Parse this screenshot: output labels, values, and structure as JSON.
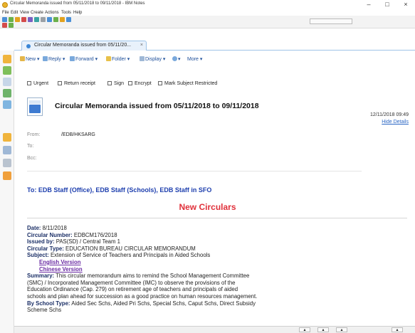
{
  "window": {
    "title": "Circular Memoranda issued from 05/11/2018 to 09/11/2018 - IBM Notes",
    "controls": {
      "minimize": "–",
      "maximize": "□",
      "close": "×"
    }
  },
  "menu": [
    "File",
    "Edit",
    "View",
    "Create",
    "Actions",
    "Tools",
    "Help"
  ],
  "tab": {
    "label": "Circular Memoranda issued from 05/11/20...",
    "close": "×"
  },
  "actions": {
    "new": "New",
    "reply": "Reply",
    "forward": "Forward",
    "folder": "Folder",
    "display": "Display",
    "more": "More"
  },
  "options": [
    "Urgent",
    "Return receipt",
    "Sign",
    "Encrypt",
    "Mark Subject Restricted"
  ],
  "message": {
    "subject": "Circular Memoranda issued from 05/11/2018 to 09/11/2018",
    "timestamp": "12/11/2018 09:49",
    "hide_details": "Hide Details",
    "from_label": "From:",
    "from_value": "/EDB/HKSARG",
    "to_label": "To:",
    "bcc_label": "Bcc:",
    "to_line": "To: EDB Staff (Office), EDB Staff (Schools), EDB Staff in SFO",
    "heading": "New Circulars"
  },
  "circular": {
    "date_label": "Date:",
    "date_value": "8/11/2018",
    "number_label": "Circular Number:",
    "number_value": "EDBCM176/2018",
    "issued_label": "Issued by:",
    "issued_value": "PAS(SD) / Central Team 1",
    "type_label": "Circular Type:",
    "type_value": "EDUCATION BUREAU CIRCULAR MEMORANDUM",
    "subject_label": "Subject:",
    "subject_value": "Extension of Service of Teachers and Principals in Aided Schools",
    "english_link": "English Version",
    "chinese_link": "Chinese Version",
    "summary_label": "Summary:",
    "summary_line1": "This circular memorandum aims to remind the School Management Committee",
    "summary_line2": "(SMC) / Incorporated Management Committee (IMC) to observe the provisions of the",
    "summary_line3": "Education Ordinance (Cap. 279) on retirement age of teachers and principals of aided",
    "summary_line4": "schools and plan ahead for succession as a good practice on human resources management.",
    "school_type_label": "By School Type:",
    "school_type_value": "Aided Sec Schs, Aided Pri Schs, Special Schs, Caput Schs, Direct Subsidy",
    "school_type_value2": "Scheme Schs"
  },
  "colors": {
    "link_blue": "#1e3fae",
    "heading_red": "#e0303a",
    "visited_link": "#6a2ba3",
    "label_navy": "#1b2f66"
  }
}
